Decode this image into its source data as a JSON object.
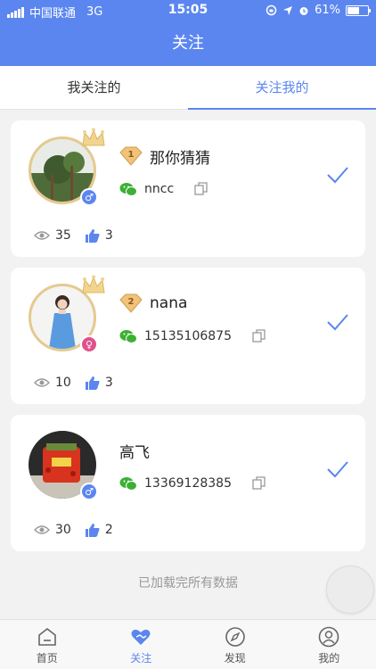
{
  "status_bar": {
    "carrier": "中国联通",
    "network": "3G",
    "time": "15:05",
    "battery": "61%",
    "battery_level": 0.61
  },
  "nav": {
    "title": "关注"
  },
  "tabs": [
    {
      "label": "我关注的",
      "active": false
    },
    {
      "label": "关注我的",
      "active": true
    }
  ],
  "cards": [
    {
      "name": "那你猜猜",
      "level": "1",
      "wechat": "nncc",
      "gender": "male",
      "views": "35",
      "likes": "3"
    },
    {
      "name": "nana",
      "level": "2",
      "wechat": "15135106875",
      "gender": "female",
      "views": "10",
      "likes": "3"
    },
    {
      "name": "高飞",
      "level": "",
      "wechat": "13369128385",
      "gender": "male",
      "views": "30",
      "likes": "2"
    }
  ],
  "footer": {
    "loaded_text": "已加载完所有数据"
  },
  "tab_bar": [
    {
      "label": "首页",
      "icon": "home-icon"
    },
    {
      "label": "关注",
      "icon": "heart-icon"
    },
    {
      "label": "发现",
      "icon": "compass-icon"
    },
    {
      "label": "我的",
      "icon": "user-icon"
    }
  ],
  "colors": {
    "accent": "#5b86f0",
    "wechat_green": "#3cb034",
    "badge_gold": "#e8b56a",
    "female": "#e0508a"
  }
}
